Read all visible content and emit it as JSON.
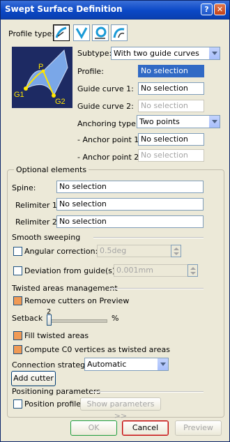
{
  "window": {
    "title": "Swept Surface Definition",
    "help_glyph": "?",
    "close_glyph": "✕"
  },
  "profile_type": {
    "label": "Profile type:"
  },
  "diagram": {
    "point_p": "P",
    "point_g1": "G1",
    "point_g2": "G2"
  },
  "subtype": {
    "label": "Subtype:",
    "value": "With two guide curves"
  },
  "profile": {
    "label": "Profile:",
    "value": "No selection"
  },
  "guide_curve_1": {
    "label": "Guide curve 1:",
    "value": "No selection"
  },
  "guide_curve_2": {
    "label": "Guide curve 2:",
    "value": "No selection"
  },
  "anchoring_type": {
    "label": "Anchoring type:",
    "value": "Two points"
  },
  "anchor_point_1": {
    "label": "- Anchor point 1:",
    "value": "No selection"
  },
  "anchor_point_2": {
    "label": "- Anchor point 2:",
    "value": "No selection"
  },
  "optional_elements": {
    "title": "Optional elements",
    "spine": {
      "label": "Spine:",
      "value": "No selection"
    },
    "relimiter_1": {
      "label": "Relimiter 1:",
      "value": "No selection"
    },
    "relimiter_2": {
      "label": "Relimiter 2:",
      "value": "No selection"
    }
  },
  "smooth_sweeping": {
    "title": "Smooth sweeping",
    "angular_correction": {
      "label": "Angular correction:",
      "value": "0.5deg",
      "checked": false
    },
    "deviation": {
      "label": "Deviation from guide(s):",
      "value": "0.001mm",
      "checked": false
    }
  },
  "twisted_areas": {
    "title": "Twisted areas management",
    "remove_cutters": {
      "label": "Remove cutters on Preview",
      "checked": true
    },
    "setback": {
      "label": "Setback",
      "value": "2",
      "unit": "%"
    },
    "fill_twisted": {
      "label": "Fill twisted areas",
      "checked": true
    },
    "compute_c0": {
      "label": "Compute C0 vertices as twisted areas",
      "checked": true
    },
    "connection_strategy": {
      "label": "Connection strategy:",
      "value": "Automatic"
    },
    "add_cutter": "Add cutter"
  },
  "positioning": {
    "title": "Positioning parameters",
    "position_profile": {
      "label": "Position profile",
      "checked": false
    },
    "show_parameters": "Show parameters >>"
  },
  "footer": {
    "ok": "OK",
    "cancel": "Cancel",
    "preview": "Preview"
  },
  "colors": {
    "accent_titlebar": "#0b48c6",
    "checked_fill": "#f09a55",
    "selection": "#316ac5"
  }
}
